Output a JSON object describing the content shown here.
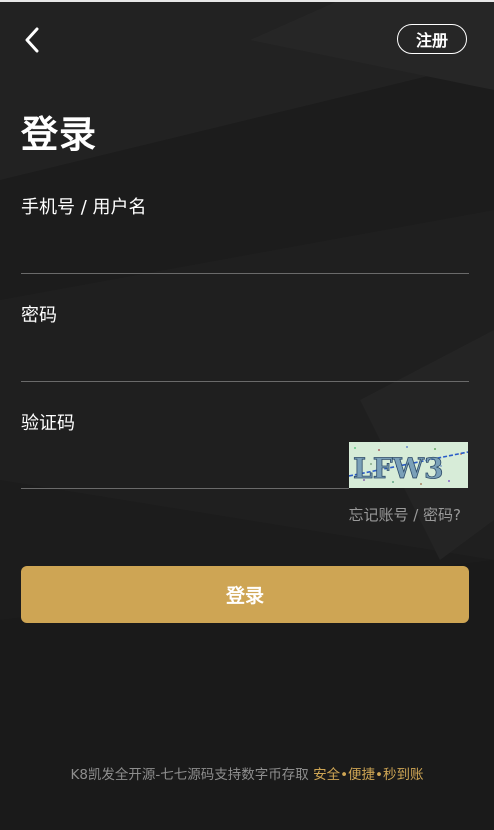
{
  "header": {
    "back_icon": "chevron-left-icon",
    "register_label": "注册"
  },
  "page": {
    "title": "登录"
  },
  "form": {
    "username_label": "手机号 / 用户名",
    "username_value": "",
    "password_label": "密码",
    "password_value": "",
    "captcha_label": "验证码",
    "captcha_value": "",
    "captcha_text": "LFW3",
    "forgot_label": "忘记账号 / 密码?",
    "login_label": "登录"
  },
  "footer": {
    "text": "K8凯发全开源-七七源码支持数字币存取",
    "highlight": "安全•便捷•秒到账"
  },
  "colors": {
    "background": "#1c1c1c",
    "accent": "#cea554",
    "muted_text": "#8e8e8e",
    "divider": "#6a6a6a"
  }
}
